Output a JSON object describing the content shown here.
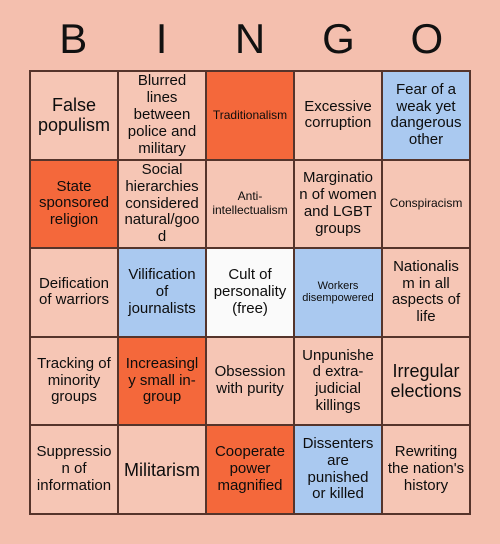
{
  "card": {
    "title": "BINGO",
    "header_letters": [
      "B",
      "I",
      "N",
      "G",
      "O"
    ],
    "background_color": "#f4bfae",
    "colors": {
      "peach": "#f6c6b5",
      "orange": "#f4683b",
      "blue": "#aac9f0",
      "white": "#fafafa",
      "border": "#55342b",
      "text": "#0d0d0d"
    },
    "grid_size": "5x5",
    "free_space": "Cult of personality (free)",
    "cells": [
      {
        "text": "False populism",
        "fill": "peach",
        "size": "lg"
      },
      {
        "text": "Blurred lines between police and military",
        "fill": "peach",
        "size": "md"
      },
      {
        "text": "Traditionalism",
        "fill": "orange",
        "size": "sm"
      },
      {
        "text": "Excessive corruption",
        "fill": "peach",
        "size": "md"
      },
      {
        "text": "Fear of a weak yet dangerous other",
        "fill": "blue",
        "size": "md"
      },
      {
        "text": "State sponsored religion",
        "fill": "orange",
        "size": "md"
      },
      {
        "text": "Social hierarchies considered natural/good",
        "fill": "peach",
        "size": "md"
      },
      {
        "text": "Anti-intellectualism",
        "fill": "peach",
        "size": "sm"
      },
      {
        "text": "Margination of women and LGBT groups",
        "fill": "peach",
        "size": "md"
      },
      {
        "text": "Conspiracism",
        "fill": "peach",
        "size": "sm"
      },
      {
        "text": "Deification of warriors",
        "fill": "peach",
        "size": "md"
      },
      {
        "text": "Vilification of journalists",
        "fill": "blue",
        "size": "md"
      },
      {
        "text": "Cult of personality (free)",
        "fill": "white",
        "size": "md"
      },
      {
        "text": "Workers disempowered",
        "fill": "blue",
        "size": "xs"
      },
      {
        "text": "Nationalism in all aspects of life",
        "fill": "peach",
        "size": "md"
      },
      {
        "text": "Tracking of minority groups",
        "fill": "peach",
        "size": "md"
      },
      {
        "text": "Increasingly small in-group",
        "fill": "orange",
        "size": "md"
      },
      {
        "text": "Obsession with purity",
        "fill": "peach",
        "size": "md"
      },
      {
        "text": "Unpunished extra-judicial killings",
        "fill": "peach",
        "size": "md"
      },
      {
        "text": "Irregular elections",
        "fill": "peach",
        "size": "lg"
      },
      {
        "text": "Suppression of information",
        "fill": "peach",
        "size": "md"
      },
      {
        "text": "Militarism",
        "fill": "peach",
        "size": "lg"
      },
      {
        "text": "Cooperate power magnified",
        "fill": "orange",
        "size": "md"
      },
      {
        "text": "Dissenters are punished or killed",
        "fill": "blue",
        "size": "md"
      },
      {
        "text": "Rewriting the nation's history",
        "fill": "peach",
        "size": "md"
      }
    ]
  }
}
